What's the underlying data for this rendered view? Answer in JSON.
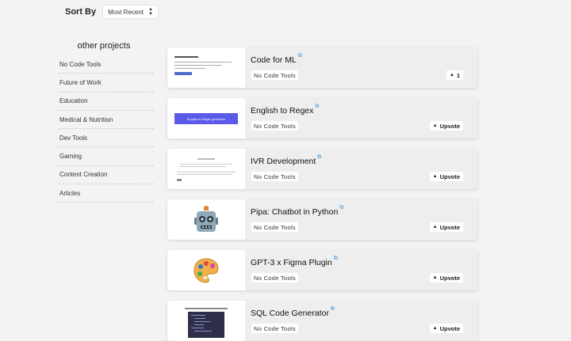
{
  "sort": {
    "label": "Sort By",
    "value": "Most Recent"
  },
  "sidebar": {
    "title": "other projects",
    "items": [
      {
        "label": "No Code Tools"
      },
      {
        "label": "Future of Work"
      },
      {
        "label": "Education"
      },
      {
        "label": "Medical & Nutrition"
      },
      {
        "label": "Dev Tools"
      },
      {
        "label": "Gaming"
      },
      {
        "label": "Content Creation"
      },
      {
        "label": "Articles"
      }
    ]
  },
  "projects": [
    {
      "title": "Code for ML",
      "tag": "No Code Tools",
      "upvote": "1",
      "thumb_icon": "form-screenshot"
    },
    {
      "title": "English to Regex",
      "tag": "No Code Tools",
      "upvote": "Upvote",
      "thumb_icon": "regex-banner",
      "thumb_text": "English to Regex generator",
      "thumb_color": "#5a59e8"
    },
    {
      "title": "IVR Development",
      "tag": "No Code Tools",
      "upvote": "Upvote",
      "thumb_icon": "document-screenshot"
    },
    {
      "title": "Pipa: Chatbot in Python",
      "tag": "No Code Tools",
      "upvote": "Upvote",
      "thumb_icon": "robot-icon",
      "thumb_glyph": "🤖"
    },
    {
      "title": "GPT-3 x Figma Plugin",
      "tag": "No Code Tools",
      "upvote": "Upvote",
      "thumb_icon": "palette-icon",
      "thumb_glyph": "🎨"
    },
    {
      "title": "SQL Code Generator",
      "tag": "No Code Tools",
      "upvote": "Upvote",
      "thumb_icon": "code-editor-screenshot",
      "thumb_color": "#2e2f48"
    }
  ],
  "colors": {
    "link_icon": "#4a9ad8",
    "background": "#f3f3f3",
    "card": "#eeeeee"
  }
}
